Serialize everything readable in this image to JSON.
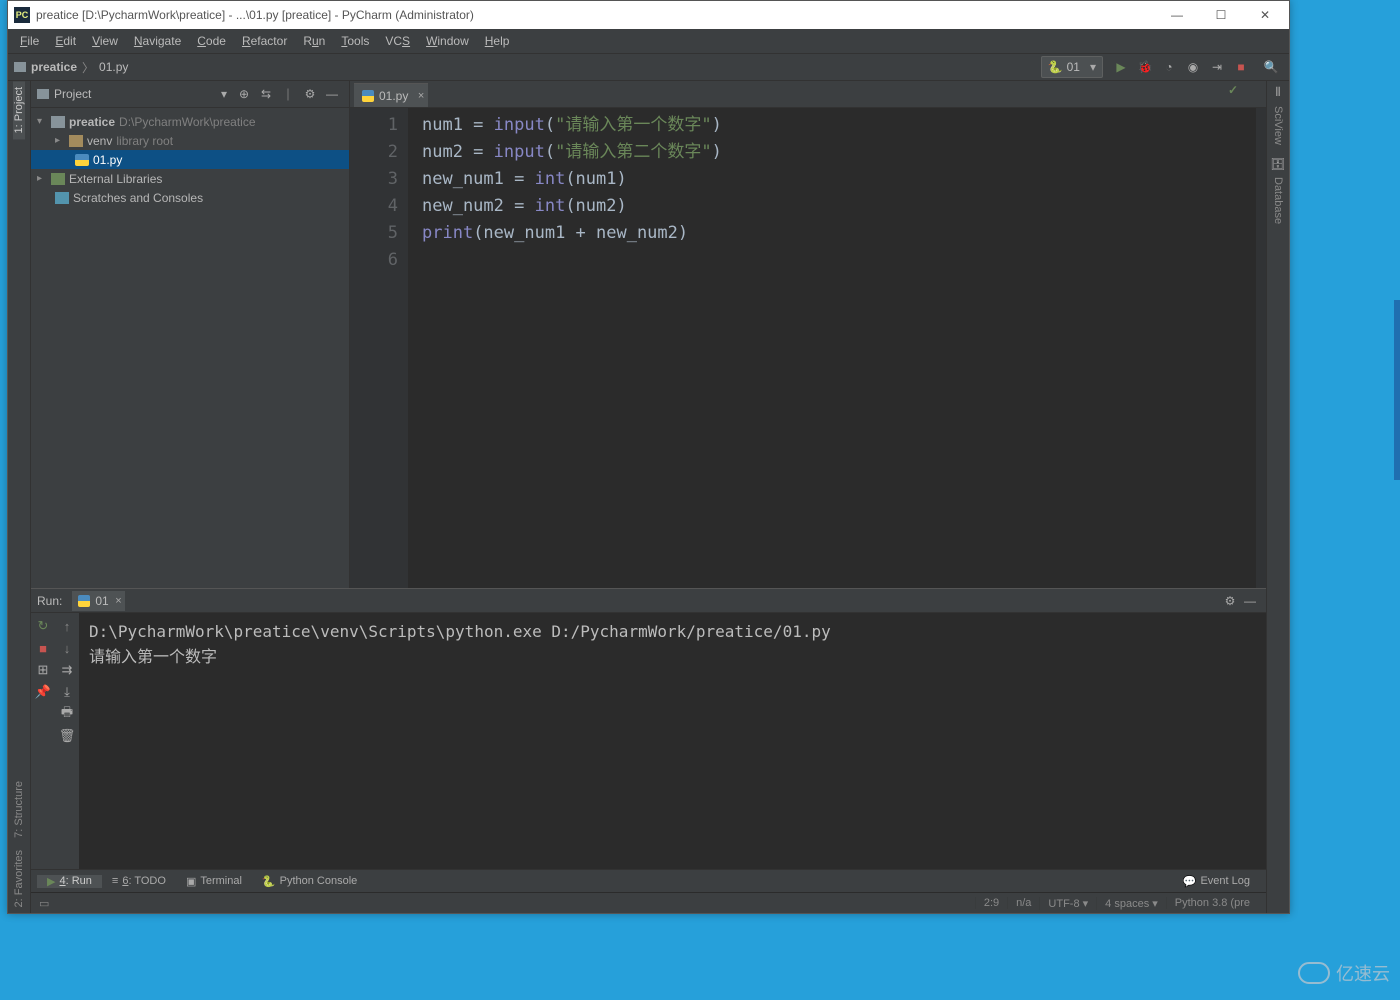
{
  "title": "preatice [D:\\PycharmWork\\preatice] - ...\\01.py [preatice] - PyCharm (Administrator)",
  "menu": [
    "File",
    "Edit",
    "View",
    "Navigate",
    "Code",
    "Refactor",
    "Run",
    "Tools",
    "VCS",
    "Window",
    "Help"
  ],
  "breadcrumb": {
    "root": "preatice",
    "file": "01.py"
  },
  "runconfig": "01",
  "leftTabs": {
    "project": "1: Project"
  },
  "rightTabs": {
    "sciview": "SciView",
    "database": "Database"
  },
  "treeHeader": "Project",
  "tree": {
    "root": {
      "name": "preatice",
      "hint": "D:\\PycharmWork\\preatice"
    },
    "venv": {
      "name": "venv",
      "hint": "library root"
    },
    "file": "01.py",
    "ext": "External Libraries",
    "scratch": "Scratches and Consoles"
  },
  "tab": "01.py",
  "gutter": [
    "1",
    "2",
    "3",
    "4",
    "5",
    "6"
  ],
  "code": {
    "l1a": "num1 = ",
    "l1b": "input",
    "l1c": "(",
    "l1d": "\"请输入第一个数字\"",
    "l1e": ")",
    "l2a": "num2 = ",
    "l2b": "input",
    "l2c": "(",
    "l2d": "\"请输入第二个数字\"",
    "l2e": ")",
    "l3a": "new_num1 = ",
    "l3b": "int",
    "l3c": "(num1)",
    "l4a": "new_num2 = ",
    "l4b": "int",
    "l4c": "(num2)",
    "l5a": "print",
    "l5b": "(new_num1 + new_num2)"
  },
  "runLabel": "Run:",
  "runTab": "01",
  "console": {
    "line1": "D:\\PycharmWork\\preatice\\venv\\Scripts\\python.exe D:/PycharmWork/preatice/01.py",
    "line2": "请输入第一个数字"
  },
  "bottomTabs": {
    "run": "4: Run",
    "todo": "6: TODO",
    "terminal": "Terminal",
    "pyconsole": "Python Console",
    "eventlog": "Event Log"
  },
  "leftSideTabs": {
    "structure": "7: Structure",
    "favorites": "2: Favorites"
  },
  "status": {
    "pos": "2:9",
    "na": "n/a",
    "enc": "UTF-8",
    "indent": "4 spaces",
    "interp": "Python 3.8 (pre"
  },
  "watermark": "亿速云"
}
